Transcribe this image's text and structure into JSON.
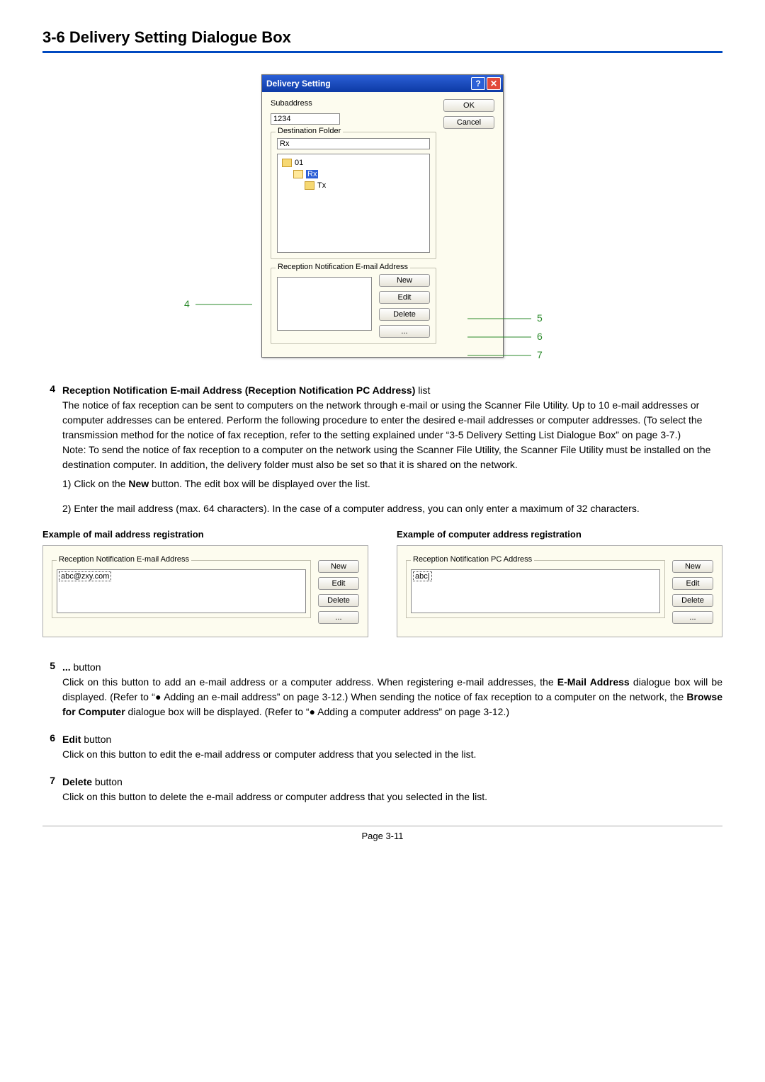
{
  "heading": "3-6 Delivery Setting Dialogue Box",
  "dialog": {
    "title": "Delivery Setting",
    "subaddress_label": "Subaddress",
    "subaddress_value": "1234",
    "ok": "OK",
    "cancel": "Cancel",
    "dest_folder_legend": "Destination Folder",
    "dest_path": "Rx",
    "tree": {
      "root": "01",
      "rx": "Rx",
      "tx": "Tx"
    },
    "notif_legend": "Reception Notification E-mail Address",
    "btn_new": "New",
    "btn_edit": "Edit",
    "btn_delete": "Delete",
    "btn_more": "..."
  },
  "callouts": {
    "c4": "4",
    "c5": "5",
    "c6": "6",
    "c7": "7"
  },
  "item4": {
    "num": "4",
    "title": "Reception Notification E-mail Address (Reception Notification PC Address)",
    "suffix": " list",
    "p1": "The notice of fax reception can be sent to computers on the network through e-mail or using the Scanner File Utility. Up to 10 e-mail addresses or computer addresses can be entered. Perform the following procedure to enter the desired e-mail addresses or computer addresses. (To select the transmission method for the notice of fax reception, refer to the setting explained under “3-5 Delivery Setting List Dialogue Box” on page 3-7.)",
    "p2": "Note: To send the notice of fax reception to a computer on the network using the Scanner File Utility, the Scanner File Utility must be installed on the destination computer. In addition, the delivery folder must also be set so that it is shared on the network.",
    "step1a": "1) Click on the ",
    "step1_bold": "New",
    "step1b": " button. The edit box will be displayed over the list.",
    "step2": "2) Enter the mail address (max. 64 characters). In the case of a computer address, you can only enter a maximum of 32 characters."
  },
  "example_mail": {
    "title": "Example of mail address registration",
    "legend": "Reception Notification E-mail Address",
    "value": "abc@zxy.com",
    "new": "New",
    "edit": "Edit",
    "delete": "Delete",
    "more": "..."
  },
  "example_pc": {
    "title": "Example of computer address registration",
    "legend": "Reception Notification PC Address",
    "value": "abc",
    "new": "New",
    "edit": "Edit",
    "delete": "Delete",
    "more": "..."
  },
  "item5": {
    "num": "5",
    "title": "...",
    "suffix": " button",
    "p_a": "Click on this button to add an e-mail address or a computer address. When registering e-mail addresses, the ",
    "b1": "E-Mail Address",
    "p_b": " dialogue box will be displayed. (Refer to “● Adding an e-mail address” on page 3-12.) When sending the notice of fax reception to a computer on the network, the ",
    "b2": "Browse for Computer",
    "p_c": " dialogue box will be displayed. (Refer to “● Adding a computer address” on page 3-12.)"
  },
  "item6": {
    "num": "6",
    "title": "Edit",
    "suffix": " button",
    "p": "Click on this button to edit the e-mail address or computer address that you selected in the list."
  },
  "item7": {
    "num": "7",
    "title": "Delete",
    "suffix": " button",
    "p": "Click on this button to delete the e-mail address or computer address that you selected in the list."
  },
  "footer": "Page 3-11"
}
